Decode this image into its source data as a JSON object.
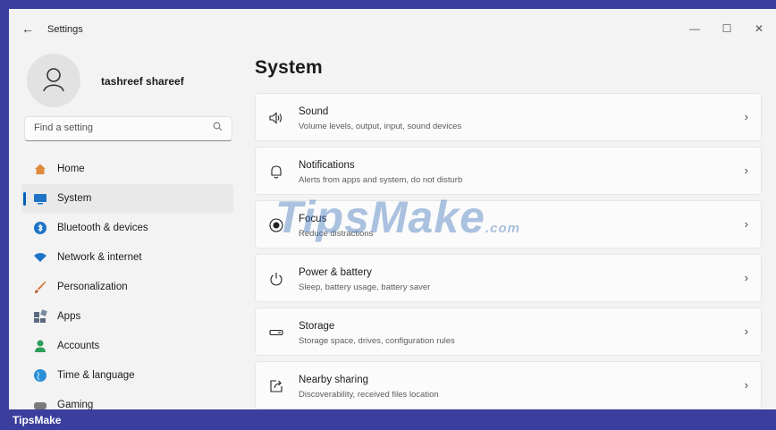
{
  "window": {
    "title": "Settings",
    "back_glyph": "←",
    "controls": {
      "minimize": "—",
      "maximize": "☐",
      "close": "✕"
    }
  },
  "user": {
    "name": "tashreef shareef",
    "avatar_icon": "user-avatar-icon"
  },
  "search": {
    "placeholder": "Find a setting",
    "value": "",
    "icon": "search-icon"
  },
  "nav": {
    "home": {
      "label": "Home",
      "icon": "home-icon",
      "color": "#e08a3c"
    },
    "system": {
      "label": "System",
      "icon": "monitor-icon",
      "color": "#1e73c8",
      "selected": true
    },
    "bluetooth": {
      "label": "Bluetooth & devices",
      "icon": "bluetooth-icon",
      "color": "#1e73c8"
    },
    "network": {
      "label": "Network & internet",
      "icon": "wifi-icon",
      "color": "#1e73c8"
    },
    "personalization": {
      "label": "Personalization",
      "icon": "brush-icon",
      "color": "#d6763a"
    },
    "apps": {
      "label": "Apps",
      "icon": "apps-icon",
      "color": "#5a6a80"
    },
    "accounts": {
      "label": "Accounts",
      "icon": "accounts-icon",
      "color": "#2e9e5a"
    },
    "time_language": {
      "label": "Time & language",
      "icon": "globe-icon",
      "color": "#2b8fd6"
    },
    "gaming": {
      "label": "Gaming",
      "icon": "gaming-icon",
      "color": "#7a7a7a"
    }
  },
  "main": {
    "title": "System",
    "cards": {
      "sound": {
        "title": "Sound",
        "subtitle": "Volume levels, output, input, sound devices",
        "icon": "speaker-icon"
      },
      "notifications": {
        "title": "Notifications",
        "subtitle": "Alerts from apps and system, do not disturb",
        "icon": "bell-icon"
      },
      "focus": {
        "title": "Focus",
        "subtitle": "Reduce distractions",
        "icon": "focus-icon"
      },
      "power": {
        "title": "Power & battery",
        "subtitle": "Sleep, battery usage, battery saver",
        "icon": "power-icon"
      },
      "storage": {
        "title": "Storage",
        "subtitle": "Storage space, drives, configuration rules",
        "icon": "storage-icon"
      },
      "nearby": {
        "title": "Nearby sharing",
        "subtitle": "Discoverability, received files location",
        "icon": "share-icon"
      }
    },
    "chevron": "›"
  },
  "watermark": {
    "main": "TipsMake",
    "suffix": ".com"
  },
  "footer": {
    "brand": "TipsMake",
    "bg_color": "#3a3f9e"
  }
}
